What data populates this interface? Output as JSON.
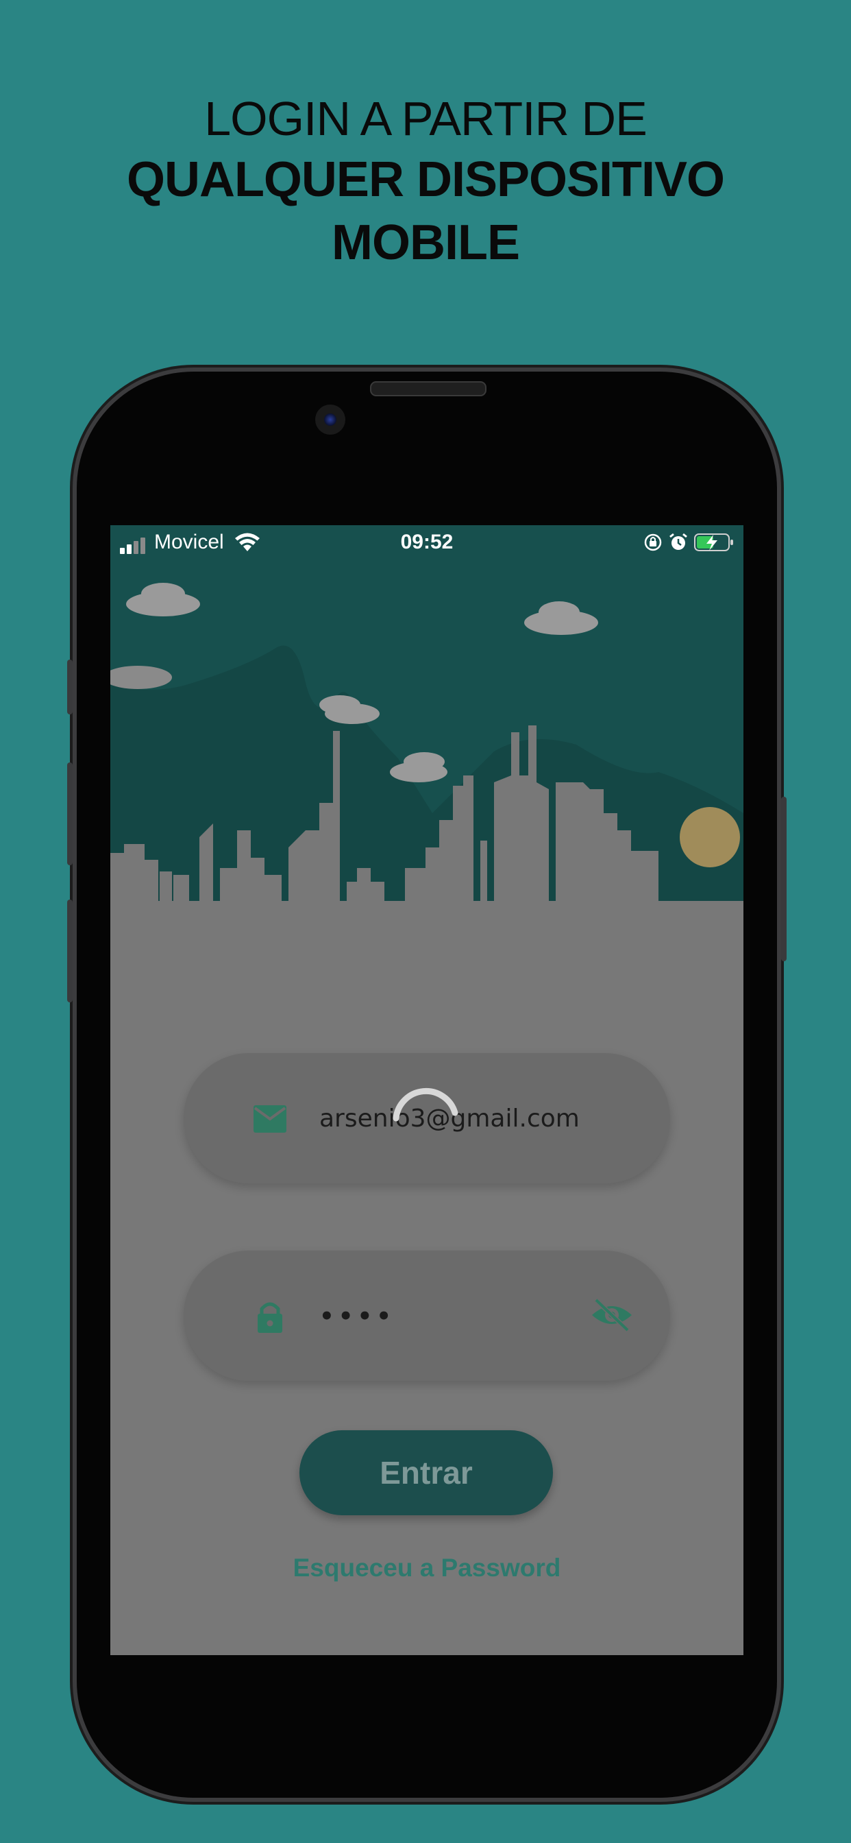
{
  "headline": {
    "line1": "LOGIN A PARTIR DE",
    "line2": "QUALQUER DISPOSITIVO",
    "line3": "MOBILE"
  },
  "status_bar": {
    "carrier": "Movicel",
    "time": "09:52",
    "icons": [
      "signal-icon",
      "wifi-icon",
      "orientation-lock-icon",
      "alarm-icon",
      "battery-charging-icon"
    ]
  },
  "login": {
    "email_value": "arsenio3@gmail.com",
    "password_value": "••••",
    "email_icon": "mail-icon",
    "password_icon": "lock-icon",
    "visibility_icon": "eye-off-icon",
    "submit_label": "Entrar",
    "forgot_label": "Esqueceu a Password",
    "loading": true
  },
  "colors": {
    "background": "#2a8584",
    "accent": "#1c4e4d",
    "link": "#2d7a6e",
    "icon": "#2f7a62"
  }
}
